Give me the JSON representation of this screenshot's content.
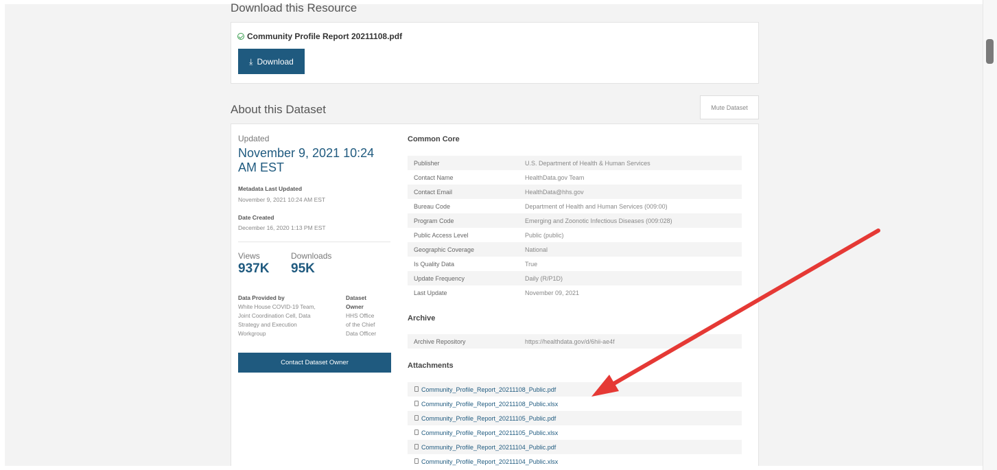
{
  "download_section": {
    "title": "Download this Resource",
    "file_name": "Community Profile Report 20211108.pdf",
    "download_label": "Download"
  },
  "about": {
    "title": "About this Dataset",
    "mute_label": "Mute Dataset",
    "updated_label": "Updated",
    "updated_value": "November 9, 2021 10:24 AM EST",
    "metadata_label": "Metadata Last Updated",
    "metadata_value": "November 9, 2021 10:24 AM EST",
    "created_label": "Date Created",
    "created_value": "December 16, 2020 1:13 PM EST",
    "views_label": "Views",
    "views_value": "937K",
    "downloads_label": "Downloads",
    "downloads_value": "95K",
    "provided_label": "Data Provided by",
    "provided_lines": [
      "White House COVID-19 Team,",
      "Joint Coordination Cell, Data",
      "Strategy and Execution",
      "Workgroup"
    ],
    "owner_label_lines": [
      "Dataset",
      "Owner"
    ],
    "owner_lines": [
      "HHS Office",
      "of the Chief",
      "Data Officer"
    ],
    "contact_label": "Contact Dataset Owner"
  },
  "common_core": {
    "title": "Common Core",
    "rows": [
      {
        "key": "Publisher",
        "value": "U.S. Department of Health & Human Services"
      },
      {
        "key": "Contact Name",
        "value": "HealthData.gov Team"
      },
      {
        "key": "Contact Email",
        "value": "HealthData@hhs.gov"
      },
      {
        "key": "Bureau Code",
        "value": "Department of Health and Human Services (009:00)"
      },
      {
        "key": "Program Code",
        "value": "Emerging and Zoonotic Infectious Diseases (009:028)"
      },
      {
        "key": "Public Access Level",
        "value": "Public (public)"
      },
      {
        "key": "Geographic Coverage",
        "value": "National"
      },
      {
        "key": "Is Quality Data",
        "value": "True"
      },
      {
        "key": "Update Frequency",
        "value": "Daily (R/P1D)"
      },
      {
        "key": "Last Update",
        "value": "November 09, 2021"
      }
    ]
  },
  "archive": {
    "title": "Archive",
    "rows": [
      {
        "key": "Archive Repository",
        "value": "https://healthdata.gov/d/6hii-ae4f"
      }
    ]
  },
  "attachments": {
    "title": "Attachments",
    "files": [
      "Community_Profile_Report_20211108_Public.pdf",
      "Community_Profile_Report_20211108_Public.xlsx",
      "Community_Profile_Report_20211105_Public.pdf",
      "Community_Profile_Report_20211105_Public.xlsx",
      "Community_Profile_Report_20211104_Public.pdf",
      "Community_Profile_Report_20211104_Public.xlsx"
    ]
  },
  "colors": {
    "accent": "#1f5a7f",
    "annotation_arrow": "#e53935",
    "success": "#3a9e4f"
  }
}
